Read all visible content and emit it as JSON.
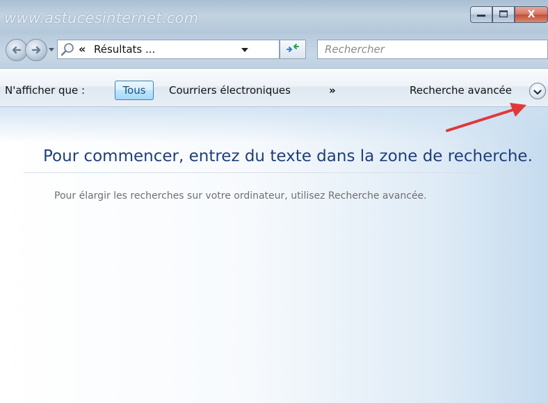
{
  "window": {
    "watermark": "www.astucesinternet.com"
  },
  "titlebar": {
    "minimize_icon": "minimize-icon",
    "maximize_icon": "maximize-icon",
    "close_icon": "close-icon",
    "close_label": "X"
  },
  "navigation": {
    "back_icon": "back-arrow-icon",
    "forward_icon": "forward-arrow-icon",
    "address": {
      "breadcrumb_chevron": "«",
      "text": "Résultats ..."
    },
    "refresh_icon": "refresh-icon",
    "search": {
      "placeholder": "Rechercher"
    }
  },
  "commandbar": {
    "show_only_label": "N'afficher que :",
    "filter_all": "Tous",
    "filter_email": "Courriers électroniques",
    "more_label": "»",
    "advanced_label": "Recherche avancée",
    "advanced_toggle_icon": "chevron-down-icon"
  },
  "content": {
    "headline": "Pour commencer, entrez du texte dans la zone de recherche.",
    "hint": "Pour élargir les recherches sur votre ordinateur, utilisez Recherche avancée."
  },
  "colors": {
    "accent": "#1e3f7a",
    "arrow": "#e0383a",
    "close_button": "#c44c37"
  }
}
